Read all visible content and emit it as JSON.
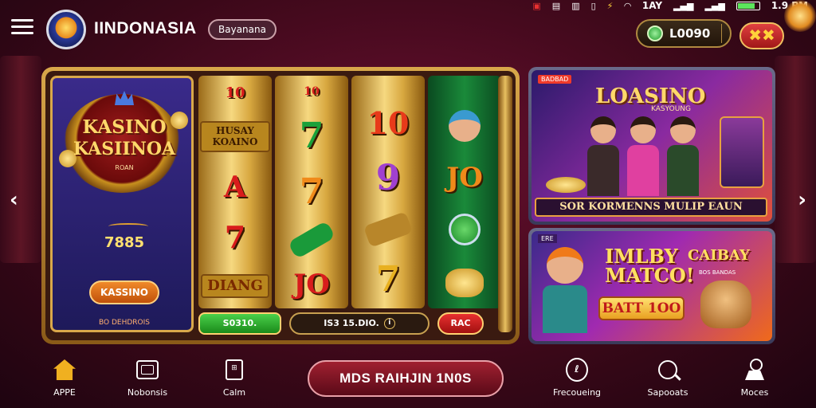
{
  "status_bar": {
    "icons": [
      "notification-icon",
      "image-icon",
      "clipboard-icon",
      "phone-icon",
      "bolt-icon",
      "wifi-icon",
      "signal-icon",
      "battery-icon"
    ],
    "signal_text": "1AY",
    "time": "1.9 PM"
  },
  "header": {
    "brand": "IINDONASIA",
    "pill_label": "Bayanana",
    "balance": "L0090",
    "close_label": "✖✖"
  },
  "slot": {
    "left_card": {
      "title_line1": "KASINO",
      "title_line2": "KASIINOA",
      "subtitle": "ROAN",
      "jackpot": "7885",
      "button": "KASSINO",
      "footer": "BO DEHDROIS"
    },
    "reels": [
      {
        "symbols": [
          "10",
          "HUSAY KOAINO",
          "A",
          "7",
          "DIANG"
        ]
      },
      {
        "symbols": [
          "10",
          "7",
          "7",
          "cash-icon",
          "JO"
        ]
      },
      {
        "symbols": [
          "",
          "10",
          "9",
          "cash-stack-icon",
          "7"
        ]
      },
      {
        "symbols": [
          "",
          "character-icon",
          "JO",
          "coin-icon",
          "coins-pile-icon"
        ]
      }
    ],
    "bet_button": "S0310.",
    "bet_display": "IS3 15.DIO.",
    "spin_button": "RAC"
  },
  "promos": [
    {
      "tag": "BADBAD",
      "title": "LOASINO",
      "subtitle": "KASYOUNG",
      "caption": "SOR KORMENNS MULIP EAUN"
    },
    {
      "tag": "ERE",
      "title": "IMLBY MATCO!",
      "title2": "CAIBAY",
      "mini": "BOS BANDAS",
      "badge": "BATT 1OO"
    }
  ],
  "cta": {
    "label": "MDS RAIHJIN 1N0S"
  },
  "nav": [
    {
      "label": "APPE",
      "icon": "home-icon"
    },
    {
      "label": "Nobonsis",
      "icon": "box-icon"
    },
    {
      "label": "Calm",
      "icon": "calculator-icon"
    },
    {
      "label": "Frecoueing",
      "icon": "clock-icon"
    },
    {
      "label": "Sapooats",
      "icon": "search-icon"
    },
    {
      "label": "Moces",
      "icon": "user-icon"
    }
  ]
}
